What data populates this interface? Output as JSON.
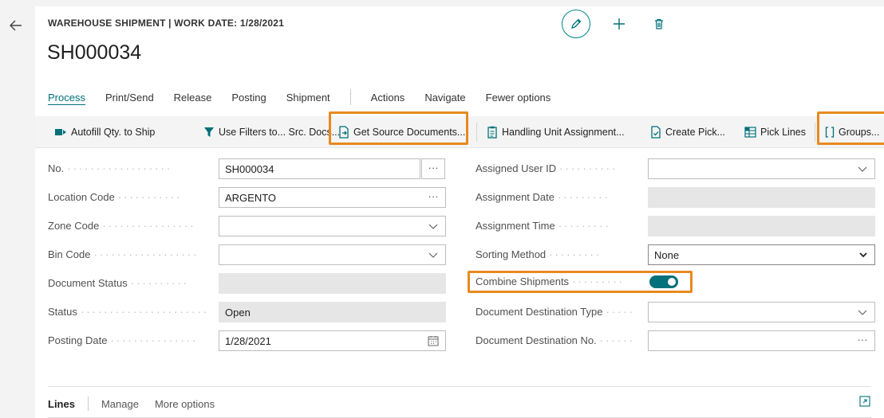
{
  "header": {
    "caption": "WAREHOUSE SHIPMENT | WORK DATE: 1/28/2021",
    "title": "SH000034"
  },
  "menu": {
    "items": [
      "Process",
      "Print/Send",
      "Release",
      "Posting",
      "Shipment"
    ],
    "items2": [
      "Actions",
      "Navigate",
      "Fewer options"
    ],
    "active": "Process"
  },
  "actions": [
    {
      "label": "Autofill Qty. to Ship",
      "icon": "autofill-icon"
    },
    {
      "label": "Use Filters to... Src. Docs...",
      "icon": "filter-icon"
    },
    {
      "label": "Get Source Documents...",
      "icon": "get-documents-icon"
    },
    {
      "label": "Handling Unit Assignment...",
      "icon": "clipboard-icon"
    },
    {
      "label": "Create Pick...",
      "icon": "create-pick-icon"
    },
    {
      "label": "Pick Lines",
      "icon": "pick-lines-icon"
    },
    {
      "label": "Groups...",
      "icon": "brackets-icon"
    }
  ],
  "fields_left": [
    {
      "label": "No.",
      "value": "SH000034"
    },
    {
      "label": "Location Code",
      "value": "ARGENTO"
    },
    {
      "label": "Zone Code",
      "value": ""
    },
    {
      "label": "Bin Code",
      "value": ""
    },
    {
      "label": "Document Status",
      "value": ""
    },
    {
      "label": "Status",
      "value": "Open"
    },
    {
      "label": "Posting Date",
      "value": "1/28/2021"
    }
  ],
  "fields_right": [
    {
      "label": "Assigned User ID",
      "value": ""
    },
    {
      "label": "Assignment Date",
      "value": ""
    },
    {
      "label": "Assignment Time",
      "value": ""
    },
    {
      "label": "Sorting Method",
      "value": "None"
    },
    {
      "label": "Combine Shipments",
      "value": "on"
    },
    {
      "label": "Document Destination Type",
      "value": ""
    },
    {
      "label": "Document Destination No.",
      "value": ""
    }
  ],
  "lines": {
    "title": "Lines",
    "items": [
      "Manage",
      "More options"
    ]
  },
  "colors": {
    "accent": "#00707a",
    "highlight": "#e8891f"
  }
}
